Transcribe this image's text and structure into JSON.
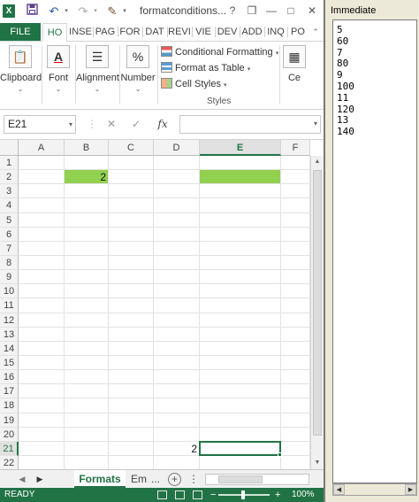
{
  "titlebar": {
    "logo": "X",
    "title": "formatconditions...",
    "help": "?",
    "restore": "❐",
    "minimize": "—",
    "maximize": "□",
    "close": "✕"
  },
  "ribbon_tabs": [
    "FILE",
    "HO",
    "INSE",
    "PAG",
    "FOR",
    "DAT",
    "REVI",
    "VIE",
    "DEV",
    "ADD",
    "INQ",
    "PO"
  ],
  "ribbon": {
    "clipboard": "Clipboard",
    "font": "Font",
    "alignment": "Alignment",
    "number": "Number",
    "conditional_formatting": "Conditional Formatting",
    "format_as_table": "Format as Table",
    "cell_styles": "Cell Styles",
    "styles_group": "Styles",
    "cells_partial": "Ce"
  },
  "formula_bar": {
    "name_box": "E21",
    "fx": "fx",
    "value": ""
  },
  "grid": {
    "columns": [
      "A",
      "B",
      "C",
      "D",
      "E",
      "F"
    ],
    "rows": [
      "1",
      "2",
      "3",
      "4",
      "5",
      "6",
      "7",
      "8",
      "9",
      "10",
      "11",
      "12",
      "13",
      "14",
      "15",
      "16",
      "17",
      "18",
      "19",
      "20",
      "21",
      "22"
    ],
    "b2_value": "2",
    "d21_value": "2",
    "selected_cell": "E21",
    "fill_color": "#92d050"
  },
  "sheets": {
    "active": "Formats",
    "other": "Em",
    "more": "..."
  },
  "status": {
    "ready": "READY",
    "zoom": "100%"
  },
  "immediate": {
    "title": "Immediate",
    "lines": [
      "5",
      "60",
      "7",
      "80",
      "9",
      "100",
      "11",
      "120",
      "13",
      "140"
    ]
  },
  "colors": {
    "excel_green": "#217346",
    "cell_fill": "#92d050"
  }
}
